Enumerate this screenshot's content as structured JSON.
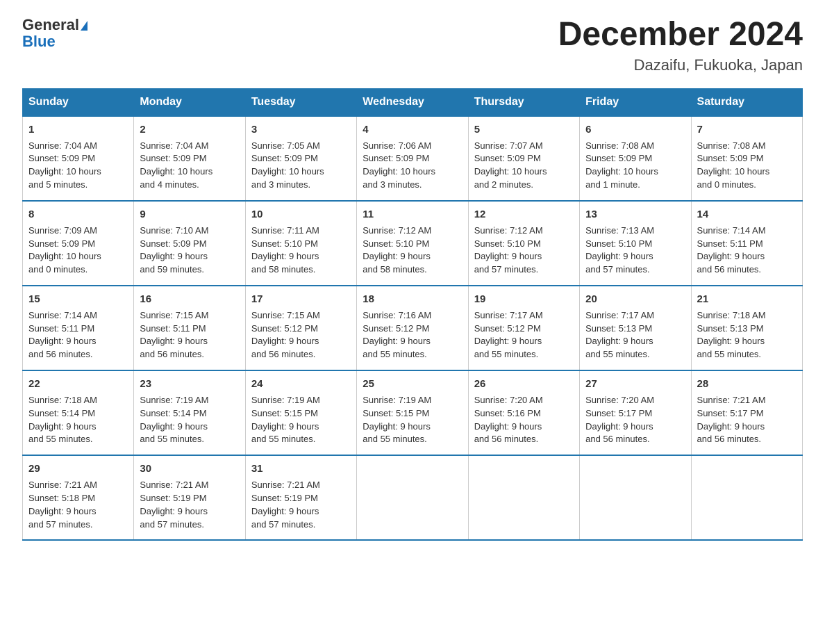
{
  "header": {
    "logo_line1": "General",
    "logo_line2": "Blue",
    "month_title": "December 2024",
    "location": "Dazaifu, Fukuoka, Japan"
  },
  "days_of_week": [
    "Sunday",
    "Monday",
    "Tuesday",
    "Wednesday",
    "Thursday",
    "Friday",
    "Saturday"
  ],
  "weeks": [
    [
      {
        "day": "1",
        "info": "Sunrise: 7:04 AM\nSunset: 5:09 PM\nDaylight: 10 hours\nand 5 minutes."
      },
      {
        "day": "2",
        "info": "Sunrise: 7:04 AM\nSunset: 5:09 PM\nDaylight: 10 hours\nand 4 minutes."
      },
      {
        "day": "3",
        "info": "Sunrise: 7:05 AM\nSunset: 5:09 PM\nDaylight: 10 hours\nand 3 minutes."
      },
      {
        "day": "4",
        "info": "Sunrise: 7:06 AM\nSunset: 5:09 PM\nDaylight: 10 hours\nand 3 minutes."
      },
      {
        "day": "5",
        "info": "Sunrise: 7:07 AM\nSunset: 5:09 PM\nDaylight: 10 hours\nand 2 minutes."
      },
      {
        "day": "6",
        "info": "Sunrise: 7:08 AM\nSunset: 5:09 PM\nDaylight: 10 hours\nand 1 minute."
      },
      {
        "day": "7",
        "info": "Sunrise: 7:08 AM\nSunset: 5:09 PM\nDaylight: 10 hours\nand 0 minutes."
      }
    ],
    [
      {
        "day": "8",
        "info": "Sunrise: 7:09 AM\nSunset: 5:09 PM\nDaylight: 10 hours\nand 0 minutes."
      },
      {
        "day": "9",
        "info": "Sunrise: 7:10 AM\nSunset: 5:09 PM\nDaylight: 9 hours\nand 59 minutes."
      },
      {
        "day": "10",
        "info": "Sunrise: 7:11 AM\nSunset: 5:10 PM\nDaylight: 9 hours\nand 58 minutes."
      },
      {
        "day": "11",
        "info": "Sunrise: 7:12 AM\nSunset: 5:10 PM\nDaylight: 9 hours\nand 58 minutes."
      },
      {
        "day": "12",
        "info": "Sunrise: 7:12 AM\nSunset: 5:10 PM\nDaylight: 9 hours\nand 57 minutes."
      },
      {
        "day": "13",
        "info": "Sunrise: 7:13 AM\nSunset: 5:10 PM\nDaylight: 9 hours\nand 57 minutes."
      },
      {
        "day": "14",
        "info": "Sunrise: 7:14 AM\nSunset: 5:11 PM\nDaylight: 9 hours\nand 56 minutes."
      }
    ],
    [
      {
        "day": "15",
        "info": "Sunrise: 7:14 AM\nSunset: 5:11 PM\nDaylight: 9 hours\nand 56 minutes."
      },
      {
        "day": "16",
        "info": "Sunrise: 7:15 AM\nSunset: 5:11 PM\nDaylight: 9 hours\nand 56 minutes."
      },
      {
        "day": "17",
        "info": "Sunrise: 7:15 AM\nSunset: 5:12 PM\nDaylight: 9 hours\nand 56 minutes."
      },
      {
        "day": "18",
        "info": "Sunrise: 7:16 AM\nSunset: 5:12 PM\nDaylight: 9 hours\nand 55 minutes."
      },
      {
        "day": "19",
        "info": "Sunrise: 7:17 AM\nSunset: 5:12 PM\nDaylight: 9 hours\nand 55 minutes."
      },
      {
        "day": "20",
        "info": "Sunrise: 7:17 AM\nSunset: 5:13 PM\nDaylight: 9 hours\nand 55 minutes."
      },
      {
        "day": "21",
        "info": "Sunrise: 7:18 AM\nSunset: 5:13 PM\nDaylight: 9 hours\nand 55 minutes."
      }
    ],
    [
      {
        "day": "22",
        "info": "Sunrise: 7:18 AM\nSunset: 5:14 PM\nDaylight: 9 hours\nand 55 minutes."
      },
      {
        "day": "23",
        "info": "Sunrise: 7:19 AM\nSunset: 5:14 PM\nDaylight: 9 hours\nand 55 minutes."
      },
      {
        "day": "24",
        "info": "Sunrise: 7:19 AM\nSunset: 5:15 PM\nDaylight: 9 hours\nand 55 minutes."
      },
      {
        "day": "25",
        "info": "Sunrise: 7:19 AM\nSunset: 5:15 PM\nDaylight: 9 hours\nand 55 minutes."
      },
      {
        "day": "26",
        "info": "Sunrise: 7:20 AM\nSunset: 5:16 PM\nDaylight: 9 hours\nand 56 minutes."
      },
      {
        "day": "27",
        "info": "Sunrise: 7:20 AM\nSunset: 5:17 PM\nDaylight: 9 hours\nand 56 minutes."
      },
      {
        "day": "28",
        "info": "Sunrise: 7:21 AM\nSunset: 5:17 PM\nDaylight: 9 hours\nand 56 minutes."
      }
    ],
    [
      {
        "day": "29",
        "info": "Sunrise: 7:21 AM\nSunset: 5:18 PM\nDaylight: 9 hours\nand 57 minutes."
      },
      {
        "day": "30",
        "info": "Sunrise: 7:21 AM\nSunset: 5:19 PM\nDaylight: 9 hours\nand 57 minutes."
      },
      {
        "day": "31",
        "info": "Sunrise: 7:21 AM\nSunset: 5:19 PM\nDaylight: 9 hours\nand 57 minutes."
      },
      {
        "day": "",
        "info": ""
      },
      {
        "day": "",
        "info": ""
      },
      {
        "day": "",
        "info": ""
      },
      {
        "day": "",
        "info": ""
      }
    ]
  ]
}
